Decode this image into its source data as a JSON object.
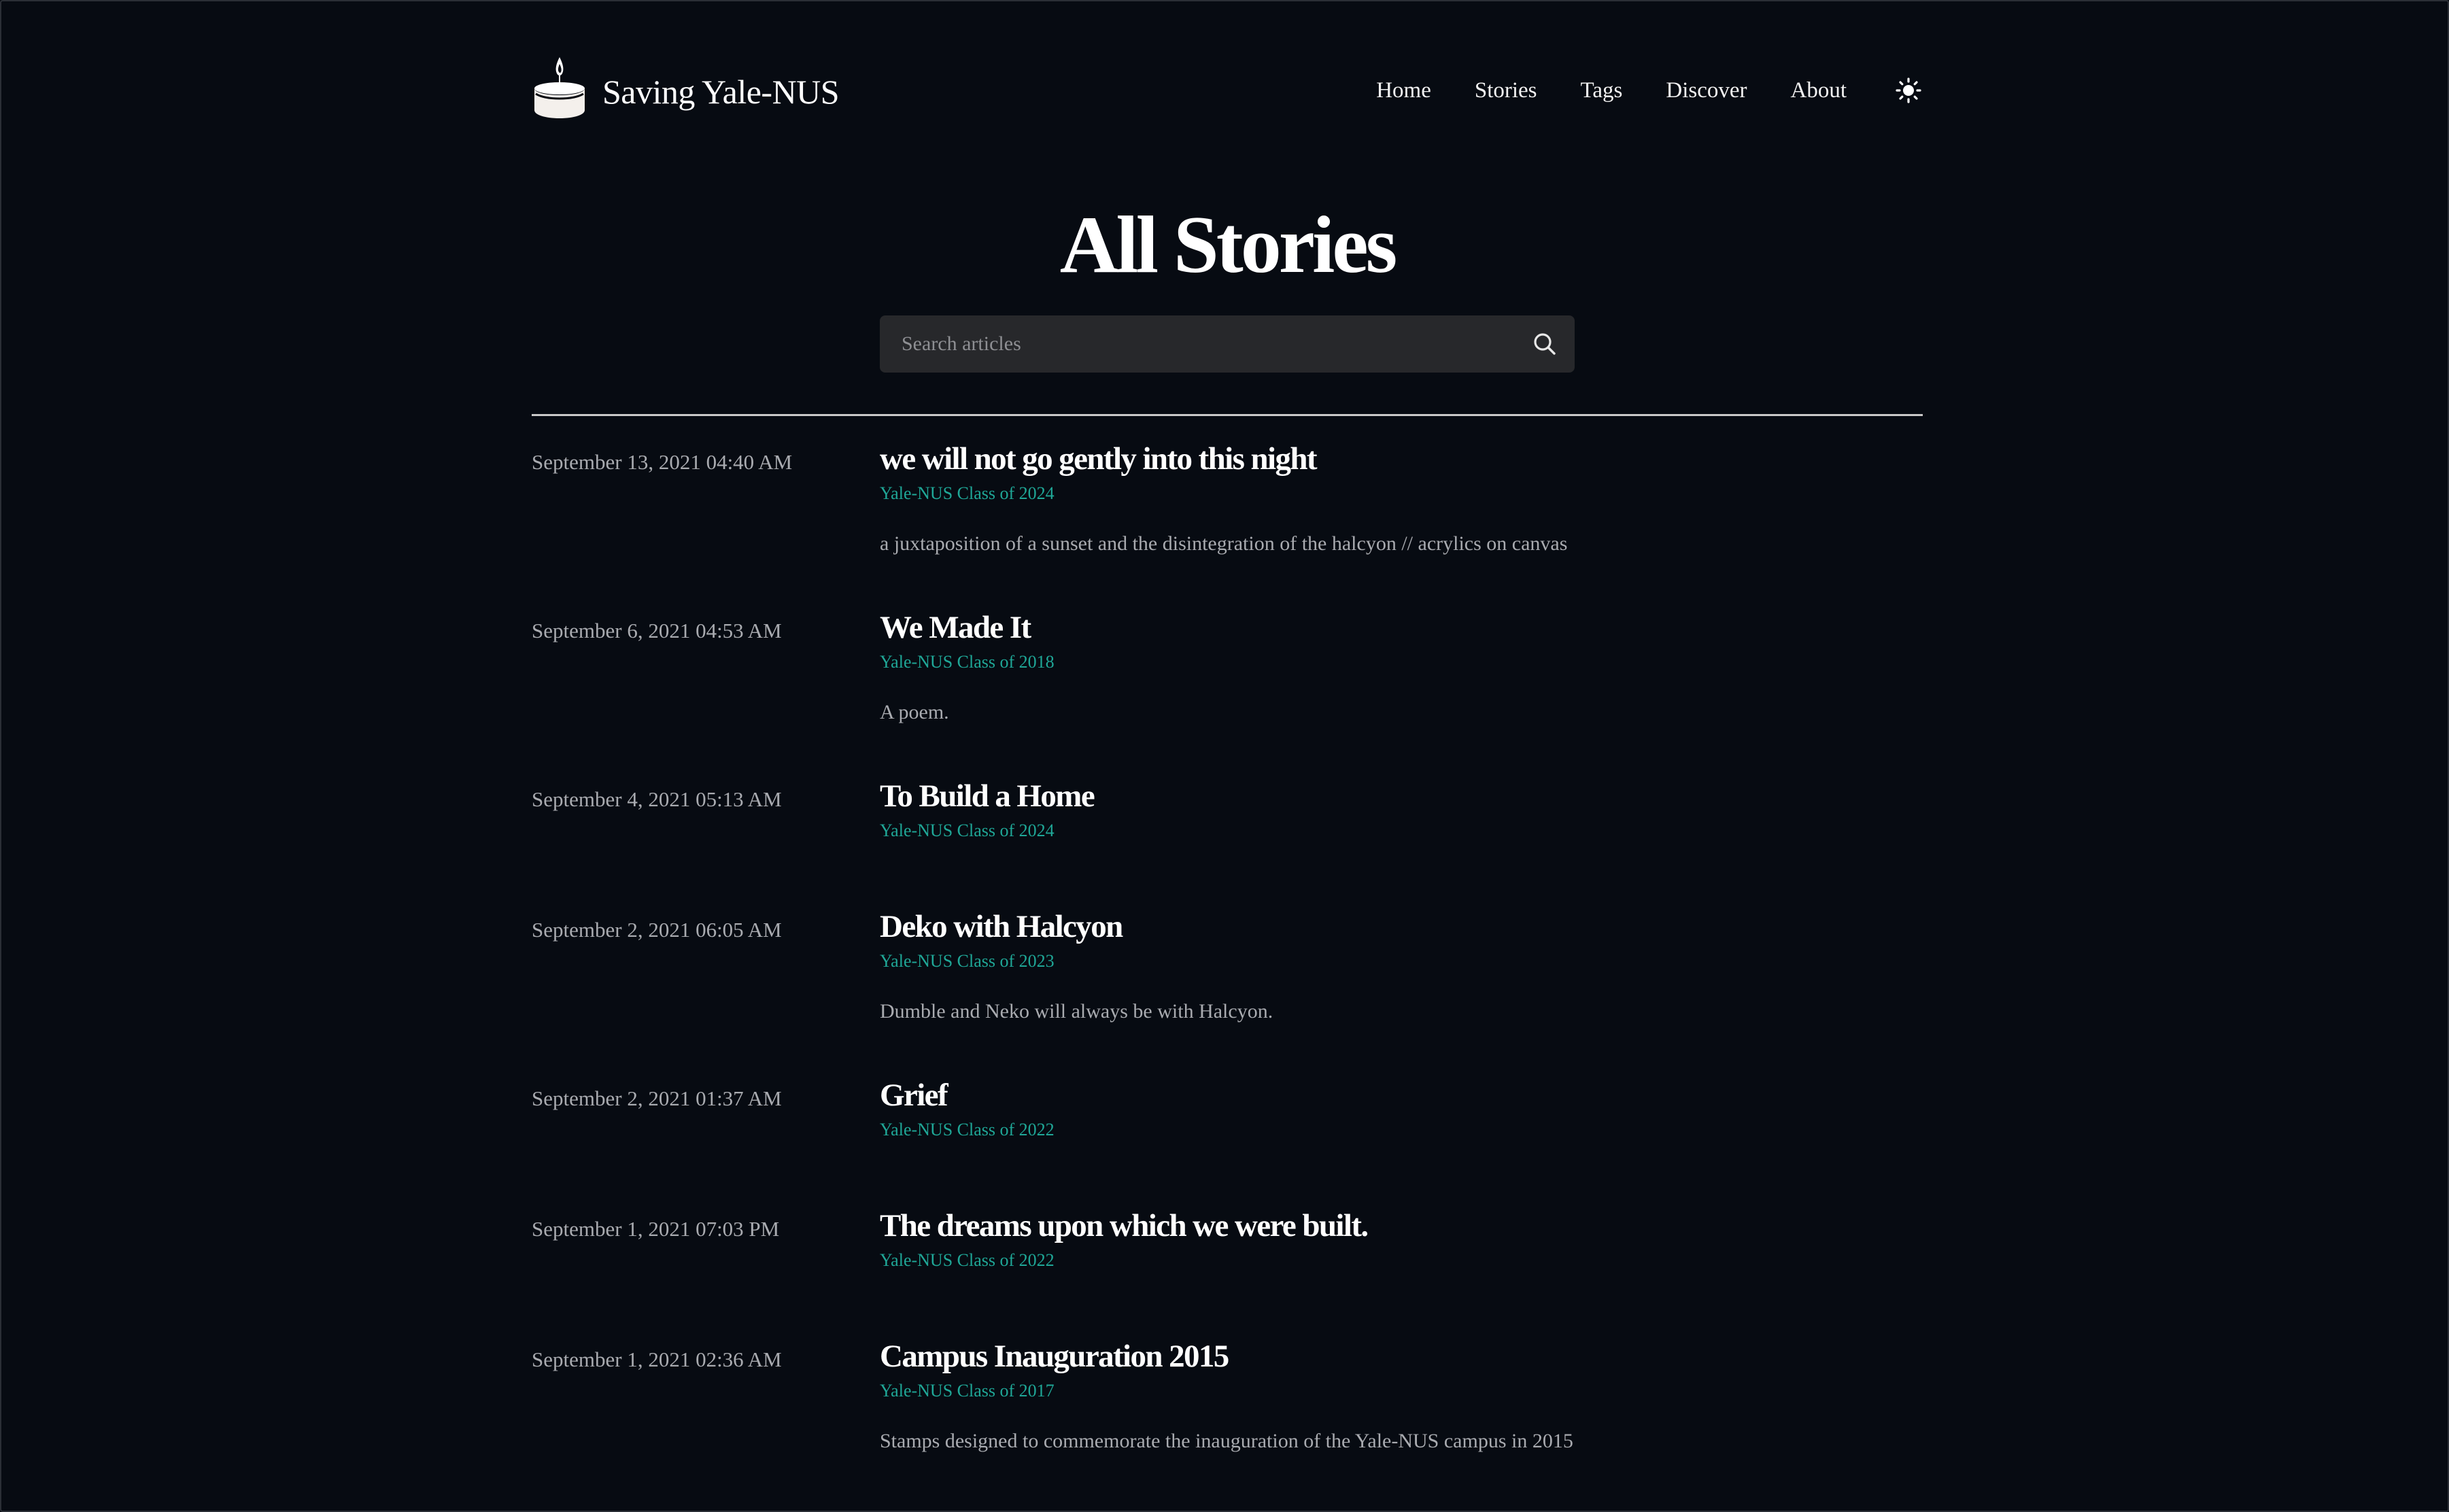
{
  "brand": {
    "title": "Saving Yale-NUS",
    "logo_icon": "candle-icon"
  },
  "nav": {
    "items": [
      {
        "label": "Home"
      },
      {
        "label": "Stories"
      },
      {
        "label": "Tags"
      },
      {
        "label": "Discover"
      },
      {
        "label": "About"
      }
    ],
    "theme_toggle_icon": "sun-icon"
  },
  "page": {
    "title": "All Stories"
  },
  "search": {
    "placeholder": "Search articles",
    "value": "",
    "icon": "search-icon"
  },
  "stories": [
    {
      "date": "September 13, 2021 04:40 AM",
      "title": "we will not go gently into this night",
      "author": "Yale-NUS Class of 2024",
      "excerpt": "a juxtaposition of a sunset and the disintegration of the halcyon // acrylics on canvas"
    },
    {
      "date": "September 6, 2021 04:53 AM",
      "title": "We Made It",
      "author": "Yale-NUS Class of 2018",
      "excerpt": "A poem."
    },
    {
      "date": "September 4, 2021 05:13 AM",
      "title": "To Build a Home",
      "author": "Yale-NUS Class of 2024",
      "excerpt": ""
    },
    {
      "date": "September 2, 2021 06:05 AM",
      "title": "Deko with Halcyon",
      "author": "Yale-NUS Class of 2023",
      "excerpt": "Dumble and Neko will always be with Halcyon."
    },
    {
      "date": "September 2, 2021 01:37 AM",
      "title": "Grief",
      "author": "Yale-NUS Class of 2022",
      "excerpt": ""
    },
    {
      "date": "September 1, 2021 07:03 PM",
      "title": "The dreams upon which we were built.",
      "author": "Yale-NUS Class of 2022",
      "excerpt": ""
    },
    {
      "date": "September 1, 2021 02:36 AM",
      "title": "Campus Inauguration 2015",
      "author": "Yale-NUS Class of 2017",
      "excerpt": "Stamps designed to commemorate the inauguration of the Yale-NUS campus in 2015"
    }
  ],
  "colors": {
    "background": "#070b12",
    "text": "#ffffff",
    "muted": "#a9abb0",
    "accent": "#1fa797",
    "search_bg": "#27282b"
  }
}
